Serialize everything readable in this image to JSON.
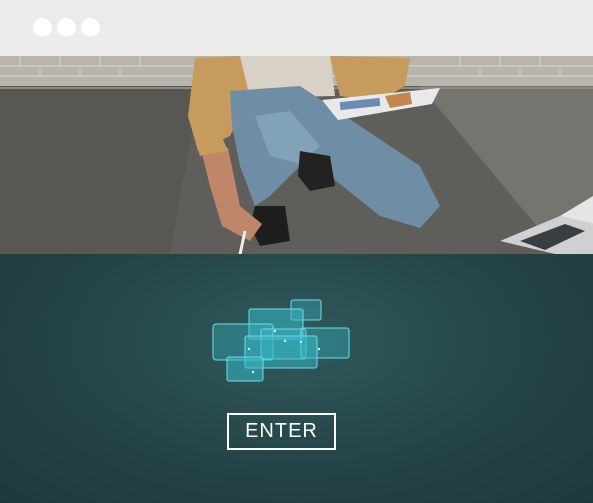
{
  "window": {
    "controls": [
      "close-dot",
      "minimize-dot",
      "maximize-dot"
    ]
  },
  "hero": {
    "image": "person-kneeling-with-tablet-and-laptop-photo"
  },
  "panel": {
    "icon": "stacked-screens-icon",
    "enter_label": "ENTER",
    "colors": {
      "panel_bg": "#254447",
      "accent": "#37b9c8",
      "button_border": "#ffffff"
    }
  }
}
